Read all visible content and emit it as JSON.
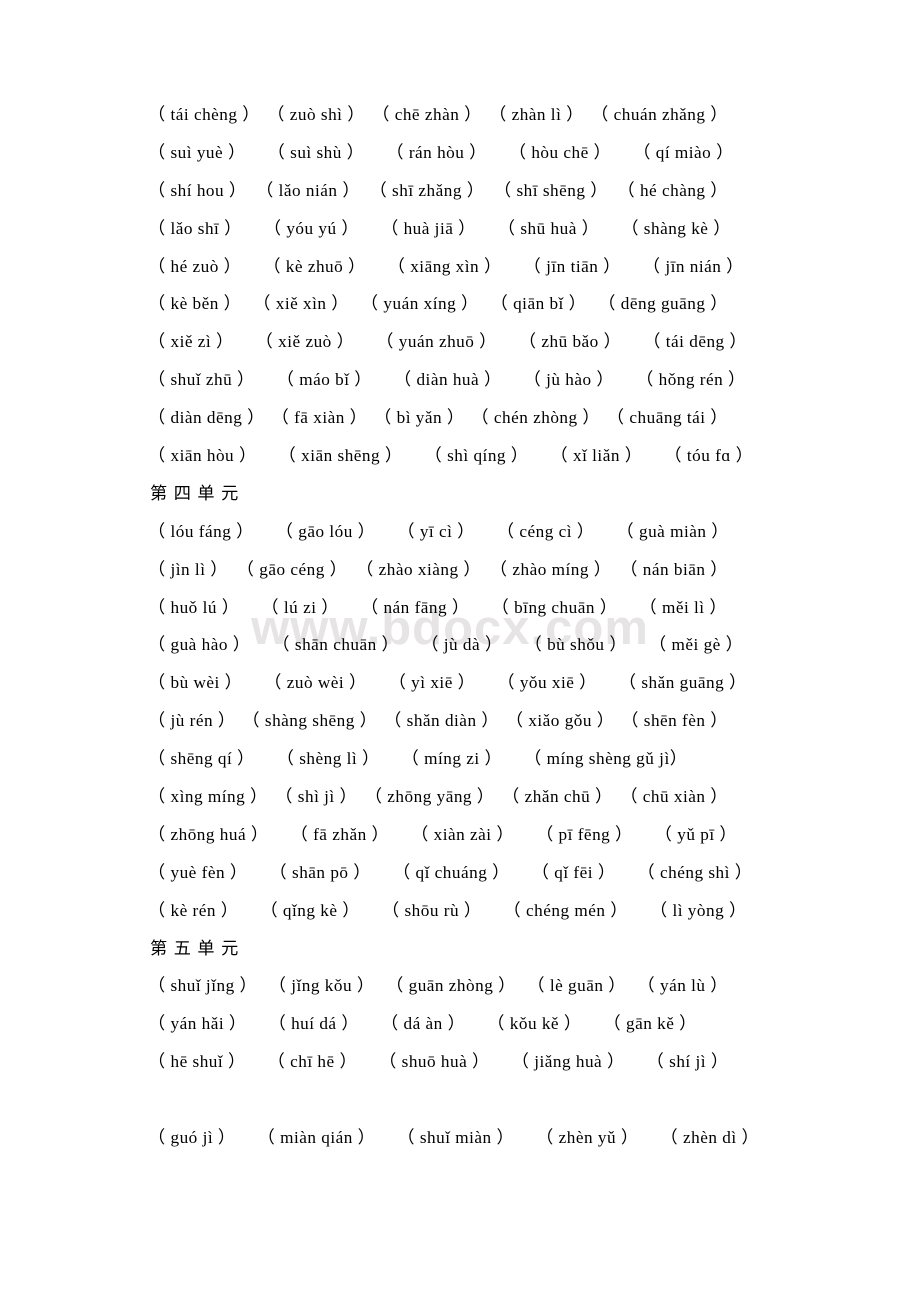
{
  "document": {
    "watermark": "www.bdocx.com",
    "background_color": "#ffffff",
    "text_color": "#000000",
    "watermark_color": "#e6e4e4"
  },
  "blocks": [
    {
      "type": "line",
      "fill": true,
      "cells": [
        "（ tái chèng ）",
        "（ zuò shì ）",
        "（ chē zhàn ）",
        "（ zhàn lì ）",
        "（ chuán zhǎng ）"
      ]
    },
    {
      "type": "line",
      "fill": false,
      "cells": [
        "（ suì yuè ）",
        "（ suì shù ）",
        "（ rán hòu ）",
        "（ hòu chē ）",
        "（ qí miào ）"
      ]
    },
    {
      "type": "line",
      "fill": true,
      "cells": [
        "（ shí hou ）",
        "（ lǎo nián ）",
        "（ shī zhǎng ）",
        "（ shī shēng ）",
        "（ hé chàng ）"
      ]
    },
    {
      "type": "line",
      "fill": false,
      "cells": [
        "（ lǎo shī ）",
        "（ yóu yú ）",
        "（ huà jiā ）",
        "（ shū huà ）",
        "（ shàng kè ）"
      ]
    },
    {
      "type": "line",
      "fill": false,
      "cells": [
        "（ hé zuò ）",
        "（ kè zhuō ）",
        "（ xiāng xìn ）",
        "（ jīn tiān ）",
        "（ jīn nián ）"
      ]
    },
    {
      "type": "line",
      "fill": true,
      "cells": [
        "（ kè běn ）",
        "（ xiě xìn ）",
        "（ yuán xíng ）",
        "（ qiān bǐ ）",
        "（ dēng guāng ）"
      ]
    },
    {
      "type": "line",
      "fill": false,
      "cells": [
        "（ xiě zì ）",
        "（ xiě zuò ）",
        "（ yuán zhuō ）",
        "（ zhū bǎo ）",
        "（ tái dēng ）"
      ]
    },
    {
      "type": "line",
      "fill": false,
      "cells": [
        "（ shuǐ zhū ）",
        "（ máo bǐ ）",
        "（ diàn huà ）",
        "（ jù hào ）",
        "（ hǒng rén ）"
      ]
    },
    {
      "type": "line",
      "fill": true,
      "cells": [
        "（ diàn dēng ）",
        "（ fā xiàn ）",
        "（ bì yǎn ）",
        "（ chén zhòng ）",
        "（ chuāng tái ）"
      ]
    },
    {
      "type": "line",
      "fill": false,
      "cells": [
        "（ xiān hòu ）",
        "（ xiān shēng ）",
        "（ shì qíng ）",
        "（ xǐ liǎn ）",
        "（ tóu fɑ ）"
      ]
    },
    {
      "type": "heading",
      "text": "第四单元"
    },
    {
      "type": "line",
      "fill": false,
      "cells": [
        "（ lóu fáng ）",
        "（ gāo lóu ）",
        "（ yī cì ）",
        "（ céng cì ）",
        "（ guà miàn ）"
      ]
    },
    {
      "type": "line",
      "fill": true,
      "cells": [
        "（ jìn lì ）",
        "（ gāo céng ）",
        "（ zhào xiàng ）",
        "（ zhào míng ）",
        "（ nán biān ）"
      ]
    },
    {
      "type": "line",
      "fill": false,
      "cells": [
        "（ huǒ lú ）",
        "（ lú zi ）",
        "（ nán fāng ）",
        "（ bīng chuān ）",
        "（ měi lì ）"
      ]
    },
    {
      "type": "line",
      "fill": false,
      "cells": [
        "（ guà hào ）",
        "（ shān chuān ）",
        "（ jù dà ）",
        "（ bù shǒu ）",
        "（ měi gè ）"
      ]
    },
    {
      "type": "line",
      "fill": false,
      "cells": [
        "（ bù wèi ）",
        "（ zuò wèi ）",
        "（ yì xiē ）",
        "（ yǒu xiē ）",
        "（ shǎn guāng ）"
      ]
    },
    {
      "type": "line",
      "fill": true,
      "cells": [
        "（ jù rén ）",
        "（ shàng shēng ）",
        "（ shǎn diàn ）",
        "（ xiǎo gǒu ）",
        "（ shēn fèn ）"
      ]
    },
    {
      "type": "line",
      "fill": false,
      "cells": [
        "（ shēng qí ）",
        "（ shèng lì ）",
        "（ míng zi ）",
        "（ míng shèng gǔ jì）"
      ]
    },
    {
      "type": "line",
      "fill": true,
      "cells": [
        "（ xìng míng ）",
        "（ shì jì ）",
        "（ zhōng yāng ）",
        "（ zhǎn chū ）",
        "（ chū xiàn ）"
      ]
    },
    {
      "type": "line",
      "fill": false,
      "cells": [
        "（ zhōng huá ）",
        "（ fā zhǎn ）",
        "（ xiàn zài ）",
        "（ pī fēng ）",
        "（ yǔ pī ）"
      ]
    },
    {
      "type": "line",
      "fill": false,
      "cells": [
        "（ yuè fèn ）",
        "（ shān pō ）",
        "（ qǐ chuáng ）",
        "（ qǐ fēi ）",
        "（ chéng shì ）"
      ]
    },
    {
      "type": "line",
      "fill": false,
      "cells": [
        "（ kè rén ）",
        "（ qǐng kè ）",
        "（ shōu rù ）",
        "（ chéng mén ）",
        "（ lì yòng ）"
      ]
    },
    {
      "type": "heading",
      "text": "第五单元"
    },
    {
      "type": "line",
      "fill": true,
      "cells": [
        "（ shuǐ jǐng ）",
        "（ jǐng kǒu ）",
        "（ guān zhòng ）",
        "（ lè guān ）",
        "（ yán lù ）"
      ]
    },
    {
      "type": "line",
      "fill": false,
      "cells": [
        "（ yán hǎi ）",
        "（ huí dá ）",
        "（ dá àn ）",
        "（ kǒu kě ）",
        "（ gān kě ）"
      ]
    },
    {
      "type": "line",
      "fill": false,
      "cells": [
        "（ hē shuǐ ）",
        "（ chī hē ）",
        "（ shuō huà ）",
        "（ jiǎng huà ）",
        "（ shí jì ）"
      ]
    },
    {
      "type": "blank"
    },
    {
      "type": "line",
      "fill": false,
      "cells": [
        "（ guó jì ）",
        "（ miàn qián ）",
        "（ shuǐ miàn ）",
        "（ zhèn yǔ ）",
        "（ zhèn dì ）"
      ]
    }
  ]
}
